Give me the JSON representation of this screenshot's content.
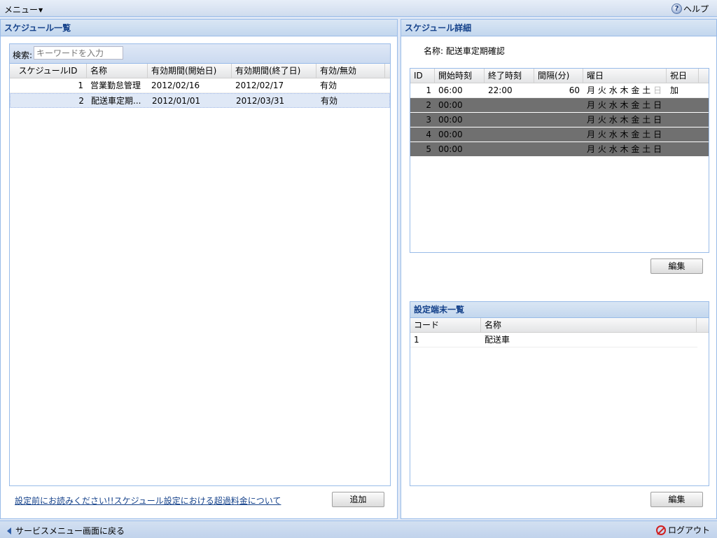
{
  "topbar": {
    "menu_label": "メニュー",
    "help_label": "ヘルプ"
  },
  "schedule_list": {
    "title": "スケジュール一覧",
    "search_label": "検索:",
    "search_placeholder": "キーワードを入力",
    "columns": [
      "スケジュールID",
      "名称",
      "有効期間(開始日)",
      "有効期間(終了日)",
      "有効/無効"
    ],
    "rows": [
      {
        "id": "1",
        "name": "営業勤怠管理",
        "start": "2012/02/16",
        "end": "2012/02/17",
        "status": "有効"
      },
      {
        "id": "2",
        "name": "配送車定期...",
        "start": "2012/01/01",
        "end": "2012/03/31",
        "status": "有効"
      }
    ],
    "note_link": "設定前にお読みください!!スケジュール設定における超過料金について",
    "add_label": "追加"
  },
  "schedule_detail": {
    "title": "スケジュール詳細",
    "name_label": "名称:",
    "name_value": "配送車定期確認",
    "columns": [
      "ID",
      "開始時刻",
      "終了時刻",
      "間隔(分)",
      "曜日",
      "祝日"
    ],
    "weekdays": [
      "月",
      "火",
      "水",
      "木",
      "金",
      "土",
      "日"
    ],
    "rows": [
      {
        "id": "1",
        "start": "06:00",
        "end": "22:00",
        "interval": "60",
        "holiday": "加"
      },
      {
        "id": "2",
        "start": "00:00",
        "end": "",
        "interval": "",
        "holiday": ""
      },
      {
        "id": "3",
        "start": "00:00",
        "end": "",
        "interval": "",
        "holiday": ""
      },
      {
        "id": "4",
        "start": "00:00",
        "end": "",
        "interval": "",
        "holiday": ""
      },
      {
        "id": "5",
        "start": "00:00",
        "end": "",
        "interval": "",
        "holiday": ""
      }
    ],
    "edit_label": "編集"
  },
  "terminals": {
    "title": "設定端末一覧",
    "columns": [
      "コード",
      "名称"
    ],
    "rows": [
      {
        "code": "1",
        "name": "配送車"
      }
    ],
    "edit_label": "編集"
  },
  "bottombar": {
    "back_label": "サービスメニュー画面に戻る",
    "logout_label": "ログアウト"
  },
  "colors": {
    "accent": "#15428b",
    "border": "#99bbe8",
    "selected_row": "#dfe8f6",
    "dark_row": "#707070",
    "logout": "#d02020"
  }
}
